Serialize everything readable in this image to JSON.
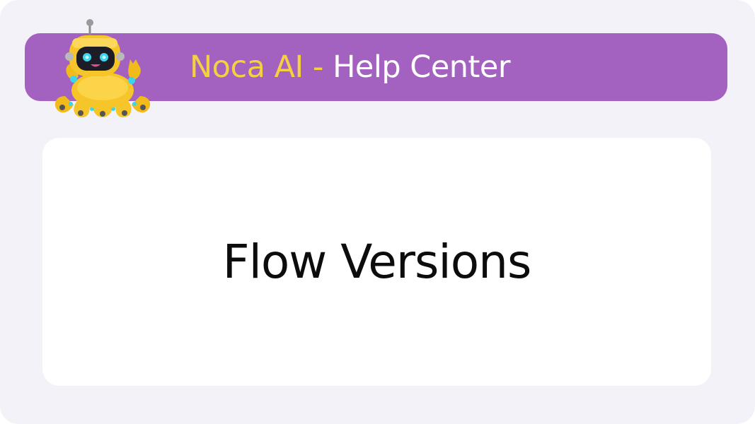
{
  "banner": {
    "brand": "Noca AI",
    "separator": " - ",
    "section": "Help Center",
    "mascot_icon": "octopus-robot-mascot-icon"
  },
  "card": {
    "title": "Flow Versions"
  },
  "colors": {
    "frame_background": "#f3f2f8",
    "banner_background": "#a362c0",
    "brand_text": "#f5d142",
    "section_text": "#ffffff",
    "card_background": "#ffffff",
    "card_text": "#0c0c0c"
  }
}
